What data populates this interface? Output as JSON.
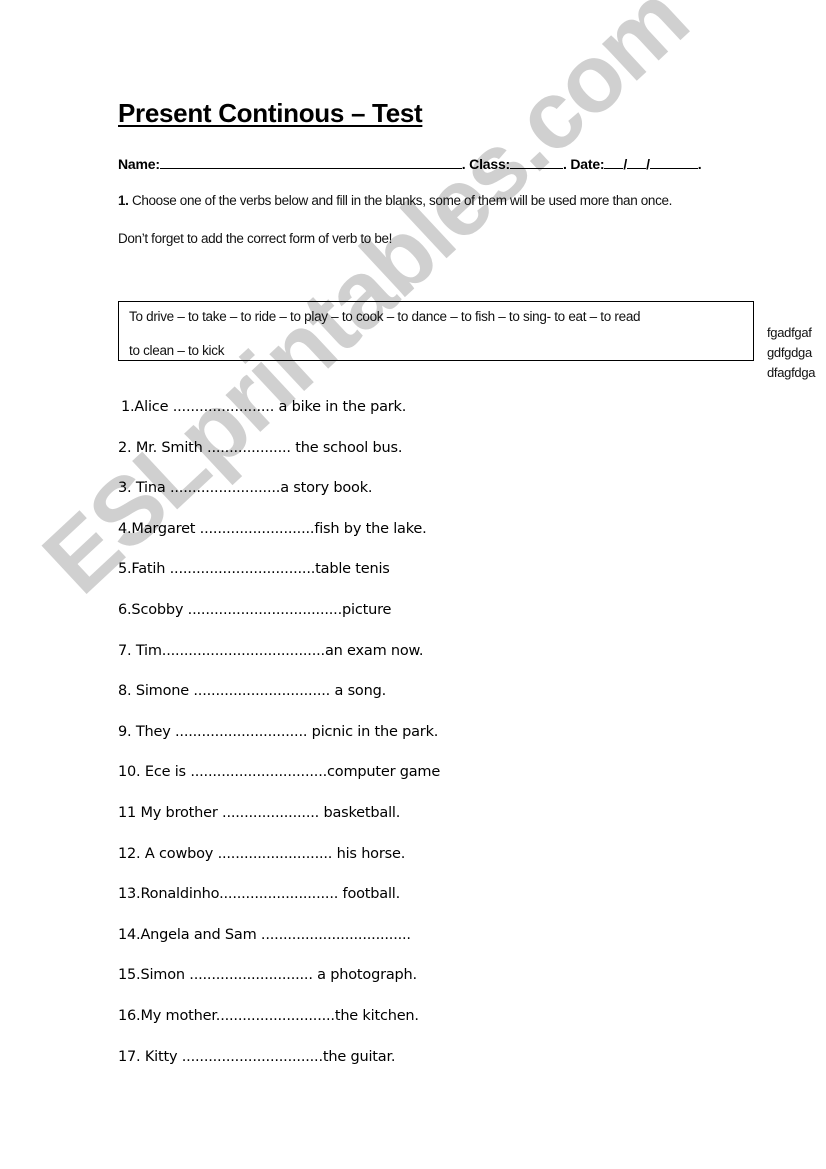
{
  "worksheet": {
    "title": "Present Continous – Test",
    "info": {
      "name_label": "Name:",
      "class_label": ". Class:",
      "date_label": ". Date:",
      "date_sep": "/",
      "end": "."
    },
    "instructions": {
      "number": "1.",
      "line1": " Choose one of the verbs below and fill in the blanks, some of them will be used more than once.",
      "line2": "Don’t forget to add the correct form of verb to be!"
    },
    "verb_box": {
      "line1": "To drive – to take – to ride – to play – to cook – to dance – to fish – to sing- to eat – to read",
      "line2": "to clean – to kick"
    },
    "side_notes": [
      "fgadfgaf",
      "gdfgdga",
      "dfagfdga"
    ],
    "questions": [
      "1.Alice ....................... a bike in the park.",
      "2. Mr. Smith ...................  the school bus.",
      "3. Tina .........................a story book.",
      "4.Margaret ..........................fish by the lake.",
      "5.Fatih .................................table tenis",
      "6.Scobby ...................................picture",
      "7. Tim.....................................an exam now.",
      "8. Simone ............................... a song.",
      "9. They .............................. picnic in the park.",
      "10. Ece is ...............................computer game",
      "11  My brother ...................... basketball.",
      "12. A cowboy .......................... his horse.",
      "13.Ronaldinho........................... football.",
      "14.Angela and Sam ..................................",
      "15.Simon ............................ a photograph.",
      "16.My mother...........................the kitchen.",
      "17. Kitty ................................the guitar."
    ]
  },
  "watermark": {
    "text": "ESLprintables.com",
    "color": "#c8c8c8"
  }
}
